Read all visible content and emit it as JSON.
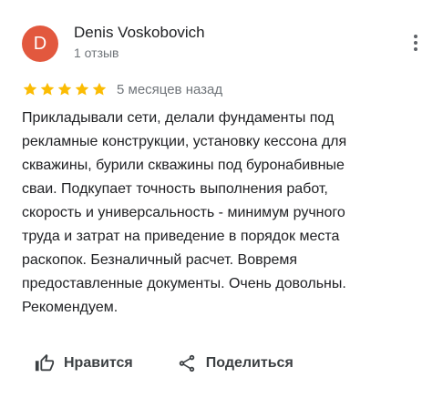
{
  "author": {
    "initial": "D",
    "name": "Denis Voskobovich",
    "review_count": "1 отзыв",
    "avatar_color": "#e2583e"
  },
  "menu": {
    "icon": "more-vert-icon"
  },
  "review": {
    "rating": 5,
    "rating_max": 5,
    "star_color": "#fbbc04",
    "date": "5 месяцев назад",
    "text": "Прикладывали сети, делали фундаменты под\nрекламные конструкции, установку кессона для\nскважины, бурили скважины под буронабивные\nсваи. Подкупает точность выполнения работ,\nскорость и универсальность - минимум ручного\nтруда и затрат на приведение в порядок места\nраскопок. Безналичный расчет. Вовремя\nпредоставленные документы. Очень довольны.\nРекомендуем."
  },
  "actions": {
    "like": {
      "label": "Нравится",
      "icon": "thumbs-up-icon"
    },
    "share": {
      "label": "Поделиться",
      "icon": "share-icon"
    }
  }
}
